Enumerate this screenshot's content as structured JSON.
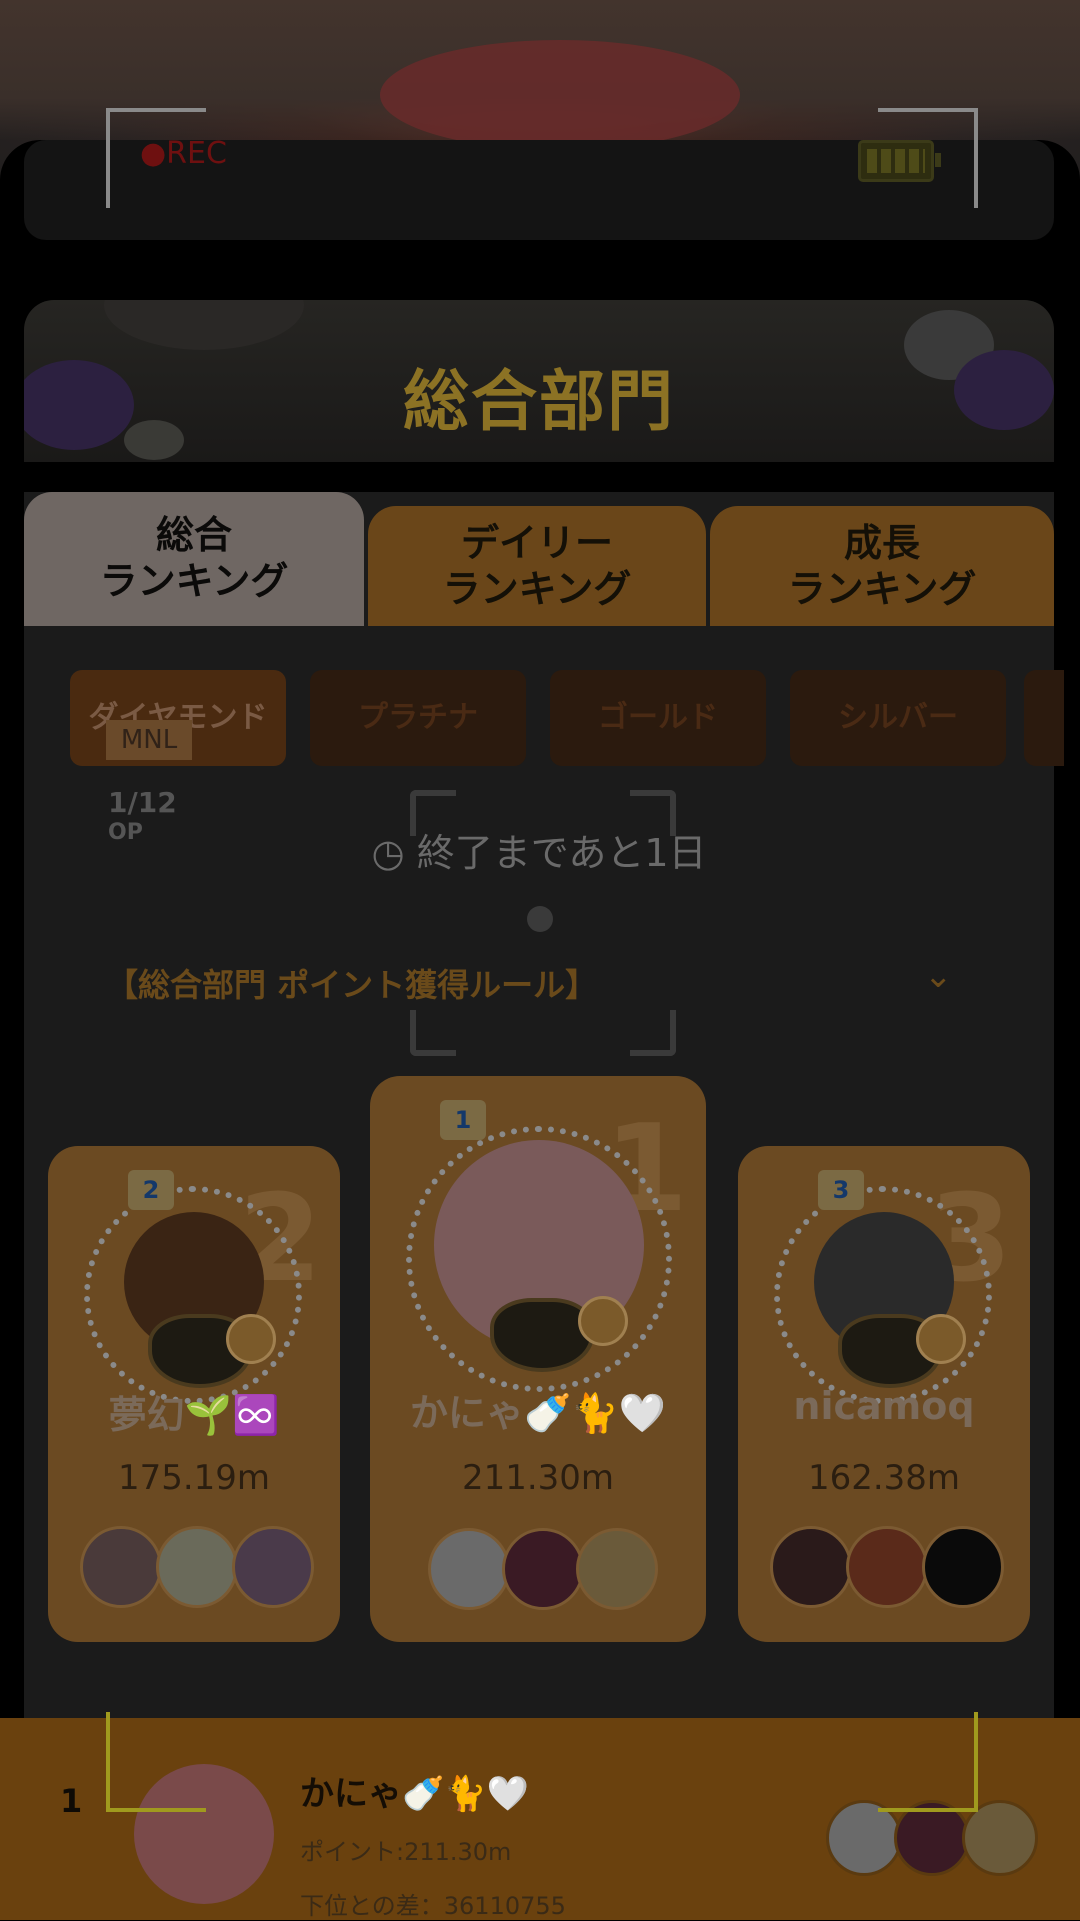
{
  "recording": {
    "rec_label": "●REC"
  },
  "banner": {
    "title": "総合部門"
  },
  "tabs": [
    {
      "line1": "総合",
      "line2": "ランキング",
      "active": true
    },
    {
      "line1": "デイリー",
      "line2": "ランキング",
      "active": false
    },
    {
      "line1": "成長",
      "line2": "ランキング",
      "active": false
    }
  ],
  "tiers": [
    "ダイヤモンド",
    "プラチナ",
    "ゴールド",
    "シルバー"
  ],
  "overlay": {
    "badge": "MNL",
    "count": "1/12",
    "op": "OP"
  },
  "timer": {
    "icon": "clock-icon",
    "text": "終了まであと1日"
  },
  "rules_link": {
    "text": "【総合部門 ポイント獲得ルール】",
    "icon": "chevron-down-icon"
  },
  "podium": [
    {
      "rank": "1",
      "name": "かにゃ🍼🐈🤍",
      "score": "211.30m"
    },
    {
      "rank": "2",
      "name": "夢幻🌱♾️",
      "score": "175.19m"
    },
    {
      "rank": "3",
      "name": "nicamoq",
      "score": "162.38m"
    }
  ],
  "my_rank": {
    "rank": "1",
    "name": "かにゃ🍼🐈🤍",
    "points": "ポイント:211.30m",
    "diff": "下位との差：36110755"
  },
  "colors": {
    "accent_gold": "#8c7224",
    "tab_orange": "#6a4619",
    "bottom_bar": "#6a410e"
  }
}
